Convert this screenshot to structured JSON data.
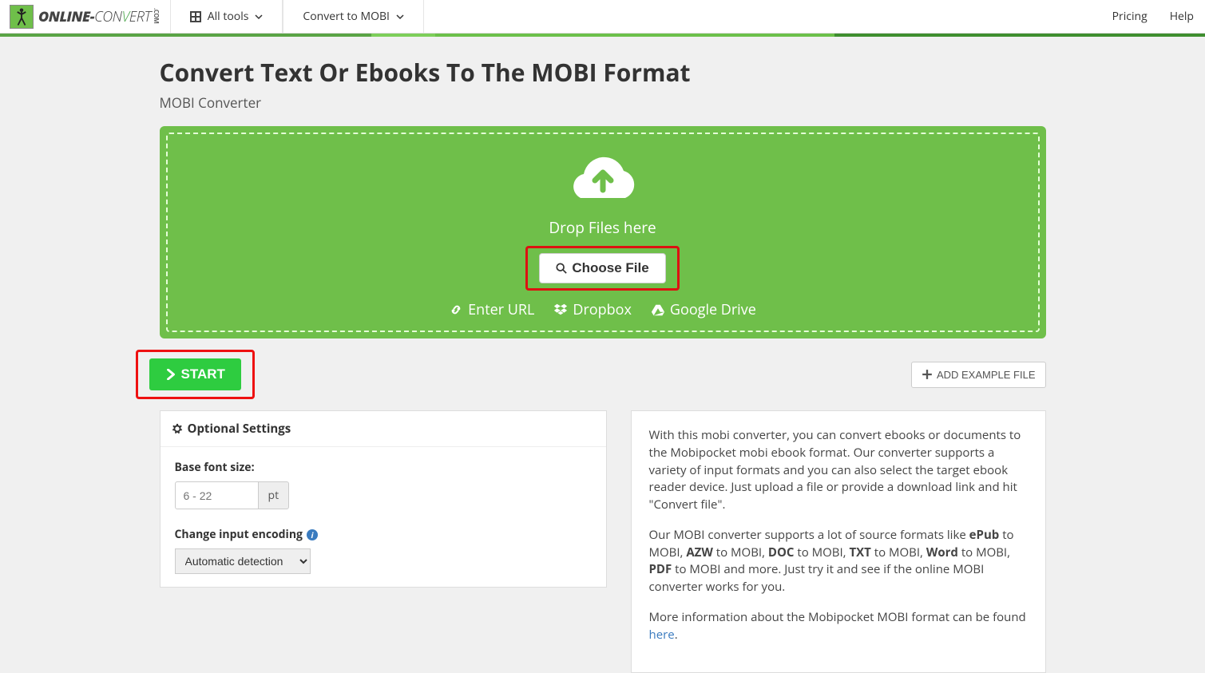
{
  "header": {
    "logo_online": "ONLINE-",
    "logo_con": "CON",
    "logo_v": "V",
    "logo_ert": "ERT",
    "logo_dotcom": ".COM",
    "all_tools": "All tools",
    "convert_to": "Convert to MOBI",
    "pricing": "Pricing",
    "help": "Help"
  },
  "page": {
    "title": "Convert Text Or Ebooks To The MOBI Format",
    "subtitle": "MOBI Converter"
  },
  "drop": {
    "text": "Drop Files here",
    "choose": "Choose File",
    "enter_url": "Enter URL",
    "dropbox": "Dropbox",
    "gdrive": "Google Drive"
  },
  "actions": {
    "start": "START",
    "add_example": "ADD EXAMPLE FILE"
  },
  "settings": {
    "header": "Optional Settings",
    "base_font_label": "Base font size:",
    "base_font_placeholder": "6 - 22",
    "pt": "pt",
    "encoding_label": "Change input encoding",
    "encoding_value": "Automatic detection"
  },
  "info": {
    "p1": "With this mobi converter, you can convert ebooks or documents to the Mobipocket mobi ebook format. Our converter supports a variety of input formats and you can also select the target ebook reader device. Just upload a file or provide a download link and hit \"Convert file\".",
    "p2_pre": "Our MOBI converter supports a lot of source formats like ",
    "p2_epub": "ePub",
    "p2_1": " to MOBI, ",
    "p2_azw": "AZW",
    "p2_2": " to MOBI, ",
    "p2_doc": "DOC",
    "p2_3": " to MOBI, ",
    "p2_txt": "TXT",
    "p2_4": " to MOBI, ",
    "p2_word": "Word",
    "p2_5": " to MOBI, ",
    "p2_pdf": "PDF",
    "p2_6": " to MOBI and more. Just try it and see if the online MOBI converter works for you.",
    "p3_pre": "More information about the Mobipocket MOBI format can be found ",
    "p3_link": "here",
    "p3_post": "."
  }
}
